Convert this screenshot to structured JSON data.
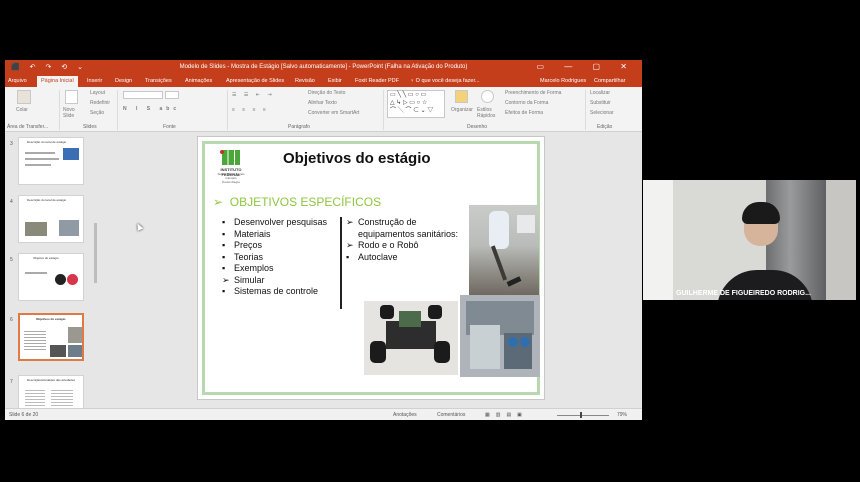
{
  "titlebar": {
    "title": "Modelo de Slides - Mostra de Estágio [Salvo automaticamente] - PowerPoint (Falha na Ativação do Produto)",
    "quick_access": "⬛ ↶ ↷ ⟲ ⌄",
    "window_controls": "▭ — ▢ ✕"
  },
  "ribbon_tabs": [
    "Arquivo",
    "Página Inicial",
    "Inserir",
    "Design",
    "Transições",
    "Animações",
    "Apresentação de Slides",
    "Revisão",
    "Exibir",
    "Foxit Reader PDF",
    "♀ O que você deseja fazer...",
    "Marcelo Rodrigues",
    "Compartilhar"
  ],
  "ribbon": {
    "clipboard": {
      "paste": "Colar",
      "group": "Área de Transfer..."
    },
    "slides": {
      "new_slide": "Novo Slide",
      "layout": "Layout",
      "reset": "Redefinir",
      "section": "Seção",
      "group": "Slides"
    },
    "font": {
      "group": "Fonte"
    },
    "paragraph": {
      "group": "Parágrafo",
      "text_direction": "Direção do Texto",
      "align_text": "Alinhar Texto",
      "smartart": "Converter em SmartArt"
    },
    "drawing": {
      "group": "Desenho",
      "arrange": "Organizar",
      "quick_styles": "Estilos Rápidos",
      "fill": "Preenchimento de Forma",
      "outline": "Contorno da Forma",
      "effects": "Efeitos de Forma"
    },
    "editing": {
      "group": "Edição",
      "find": "Localizar",
      "replace": "Substituir",
      "select": "Selecionar"
    }
  },
  "thumbnails": [
    {
      "num": "3",
      "title": "Descrição do local de estágio"
    },
    {
      "num": "4",
      "title": "Descrição do local de estágio"
    },
    {
      "num": "5",
      "title": "Objetivo do estágio"
    },
    {
      "num": "6",
      "title": "Objetivos do estágio",
      "selected": true
    },
    {
      "num": "7",
      "title": "Descrição/Atividades das atividades"
    }
  ],
  "slide": {
    "title": "Objetivos do estágio",
    "logo_text": "INSTITUTO FEDERAL",
    "logo_subtext": "Sul de Minas Gerais\nCampus\nPouso Alegre",
    "subtitle": "OBJETIVOS ESPECÍFICOS",
    "subtitle_marker": "➢",
    "left_bullets": [
      "Desenvolver pesquisas",
      "Materiais",
      "Preços",
      "Teorias",
      "Exemplos",
      "Simular",
      "Sistemas de controle"
    ],
    "left_markers": [
      "▪",
      "▪",
      "▪",
      "▪",
      "▪",
      "➢",
      "▪"
    ],
    "right_bullets": [
      "Construção de equipamentos sanitários:",
      "Rodo e o Robô",
      "Autoclave"
    ],
    "right_markers": [
      "➢",
      "➢",
      "▪"
    ]
  },
  "statusbar": {
    "slide_info": "Slide 6 de 20",
    "notes": "Anotações",
    "comments": "Comentários",
    "zoom": "79%"
  },
  "participant": {
    "name": "GUILHERME DE FIGUEIREDO RODRIG..."
  },
  "colors": {
    "accent": "#c43e1c",
    "subtitle": "#8dc63f",
    "frame": "#b8d9b0"
  }
}
